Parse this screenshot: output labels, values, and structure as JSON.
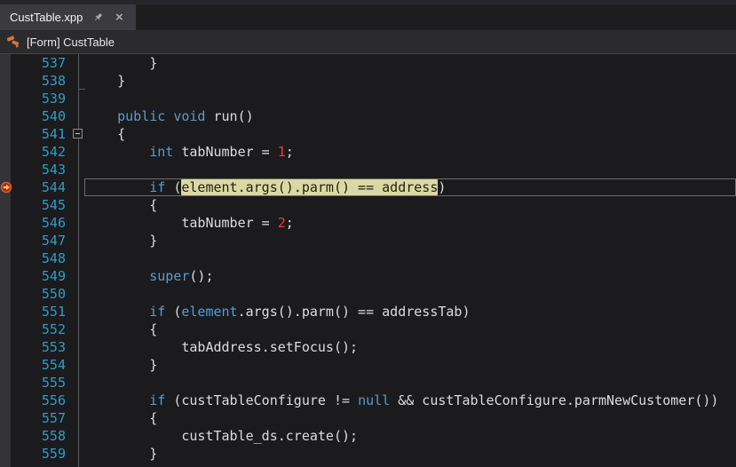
{
  "tab": {
    "title": "CustTable.xpp",
    "close_glyph": "×"
  },
  "breadcrumb": {
    "label": "[Form] CustTable"
  },
  "icons": {
    "tab_pin": "pin-icon",
    "tab_close": "close-icon",
    "breadcrumb": "form-designer-icon",
    "line_544_gutter": "breakpoint-current-statement-icon",
    "fold_open_line_541": "fold-collapse-box",
    "fold_end_line_538": "fold-region-end-tick"
  },
  "colors": {
    "editor_background": "#1B1B1D",
    "glyph_margin": "#333338",
    "tab_background": "#3A3A3F",
    "breadcrumb_background": "#2B2B2E",
    "line_number": "#2E9CC9",
    "keyword": "#569CD6",
    "plain_text": "#DCDCDC",
    "number_literal": "#F03A3A",
    "debug_highlight_background": "#D9D9A3",
    "debug_highlight_text": "#23230E",
    "breakpoint_ring": "#E3503E",
    "breakpoint_fill": "#8E2F28",
    "breakpoint_arrow": "#FFC32E",
    "breadcrumb_icon": "#D4763B"
  },
  "editor": {
    "first_line_number": 537,
    "last_line_number": 559,
    "lines": [
      {
        "num": 537,
        "tokens": [
          [
            "        }",
            "p"
          ]
        ]
      },
      {
        "num": 538,
        "tokens": [
          [
            "    }",
            "p"
          ]
        ],
        "fold": "end"
      },
      {
        "num": 539,
        "tokens": []
      },
      {
        "num": 540,
        "tokens": [
          [
            "    ",
            "p"
          ],
          [
            "public",
            "k"
          ],
          [
            " ",
            "p"
          ],
          [
            "void",
            "k"
          ],
          [
            " run()",
            "p"
          ]
        ]
      },
      {
        "num": 541,
        "tokens": [
          [
            "    {",
            "p"
          ]
        ],
        "fold": "open"
      },
      {
        "num": 542,
        "tokens": [
          [
            "        ",
            "p"
          ],
          [
            "int",
            "k"
          ],
          [
            " tabNumber = ",
            "p"
          ],
          [
            "1",
            "n"
          ],
          [
            ";",
            "p"
          ]
        ]
      },
      {
        "num": 543,
        "tokens": []
      },
      {
        "num": 544,
        "tokens": [
          [
            "        ",
            "p"
          ],
          [
            "if",
            "k"
          ],
          [
            " (",
            "p"
          ],
          [
            "element.args().parm() == address",
            "h"
          ],
          [
            ")",
            "p"
          ]
        ],
        "glyph": "breakpoint-current",
        "current": true
      },
      {
        "num": 545,
        "tokens": [
          [
            "        {",
            "p"
          ]
        ]
      },
      {
        "num": 546,
        "tokens": [
          [
            "            tabNumber = ",
            "p"
          ],
          [
            "2",
            "n"
          ],
          [
            ";",
            "p"
          ]
        ]
      },
      {
        "num": 547,
        "tokens": [
          [
            "        }",
            "p"
          ]
        ]
      },
      {
        "num": 548,
        "tokens": []
      },
      {
        "num": 549,
        "tokens": [
          [
            "        ",
            "p"
          ],
          [
            "super",
            "k"
          ],
          [
            "();",
            "p"
          ]
        ]
      },
      {
        "num": 550,
        "tokens": []
      },
      {
        "num": 551,
        "tokens": [
          [
            "        ",
            "p"
          ],
          [
            "if",
            "k"
          ],
          [
            " (",
            "p"
          ],
          [
            "element",
            "k"
          ],
          [
            ".args().parm() == addressTab)",
            "p"
          ]
        ]
      },
      {
        "num": 552,
        "tokens": [
          [
            "        {",
            "p"
          ]
        ]
      },
      {
        "num": 553,
        "tokens": [
          [
            "            tabAddress.setFocus();",
            "p"
          ]
        ]
      },
      {
        "num": 554,
        "tokens": [
          [
            "        }",
            "p"
          ]
        ]
      },
      {
        "num": 555,
        "tokens": []
      },
      {
        "num": 556,
        "tokens": [
          [
            "        ",
            "p"
          ],
          [
            "if",
            "k"
          ],
          [
            " (custTableConfigure != ",
            "p"
          ],
          [
            "null",
            "k"
          ],
          [
            " && custTableConfigure.parmNewCustomer())",
            "p"
          ]
        ]
      },
      {
        "num": 557,
        "tokens": [
          [
            "        {",
            "p"
          ]
        ]
      },
      {
        "num": 558,
        "tokens": [
          [
            "            custTable_ds.create();",
            "p"
          ]
        ]
      },
      {
        "num": 559,
        "tokens": [
          [
            "        }",
            "p"
          ]
        ]
      }
    ]
  }
}
